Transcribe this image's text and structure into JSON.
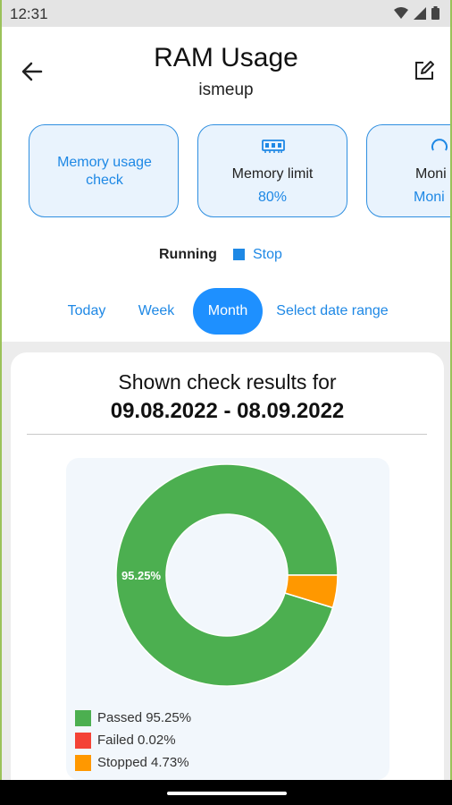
{
  "status_bar": {
    "time": "12:31"
  },
  "header": {
    "title": "RAM Usage",
    "subtitle": "ismeup"
  },
  "cards": [
    {
      "label": "Memory usage check"
    },
    {
      "label": "Memory limit",
      "value": "80%"
    },
    {
      "label_partial": "Moni",
      "value_partial": "Moni"
    }
  ],
  "status": {
    "running_label": "Running",
    "stop_label": "Stop"
  },
  "tabs": [
    {
      "label": "Today"
    },
    {
      "label": "Week"
    },
    {
      "label": "Month",
      "active": true
    },
    {
      "label": "Select date range"
    }
  ],
  "results": {
    "title": "Shown check results for",
    "range": "09.08.2022 - 08.09.2022"
  },
  "chart_data": {
    "type": "pie",
    "donut": true,
    "slices": [
      {
        "name": "Passed",
        "value": 95.25,
        "color": "#4caf50"
      },
      {
        "name": "Failed",
        "value": 0.02,
        "color": "#f44336"
      },
      {
        "name": "Stopped",
        "value": 4.73,
        "color": "#ff9800"
      }
    ],
    "data_labels": [
      "95.25%"
    ],
    "legend": [
      "Passed 95.25%",
      "Failed 0.02%",
      "Stopped 4.73%"
    ],
    "legend_position": "bottom-left"
  },
  "colors": {
    "accent": "#1e88e5",
    "card_bg": "#e9f3fd"
  }
}
